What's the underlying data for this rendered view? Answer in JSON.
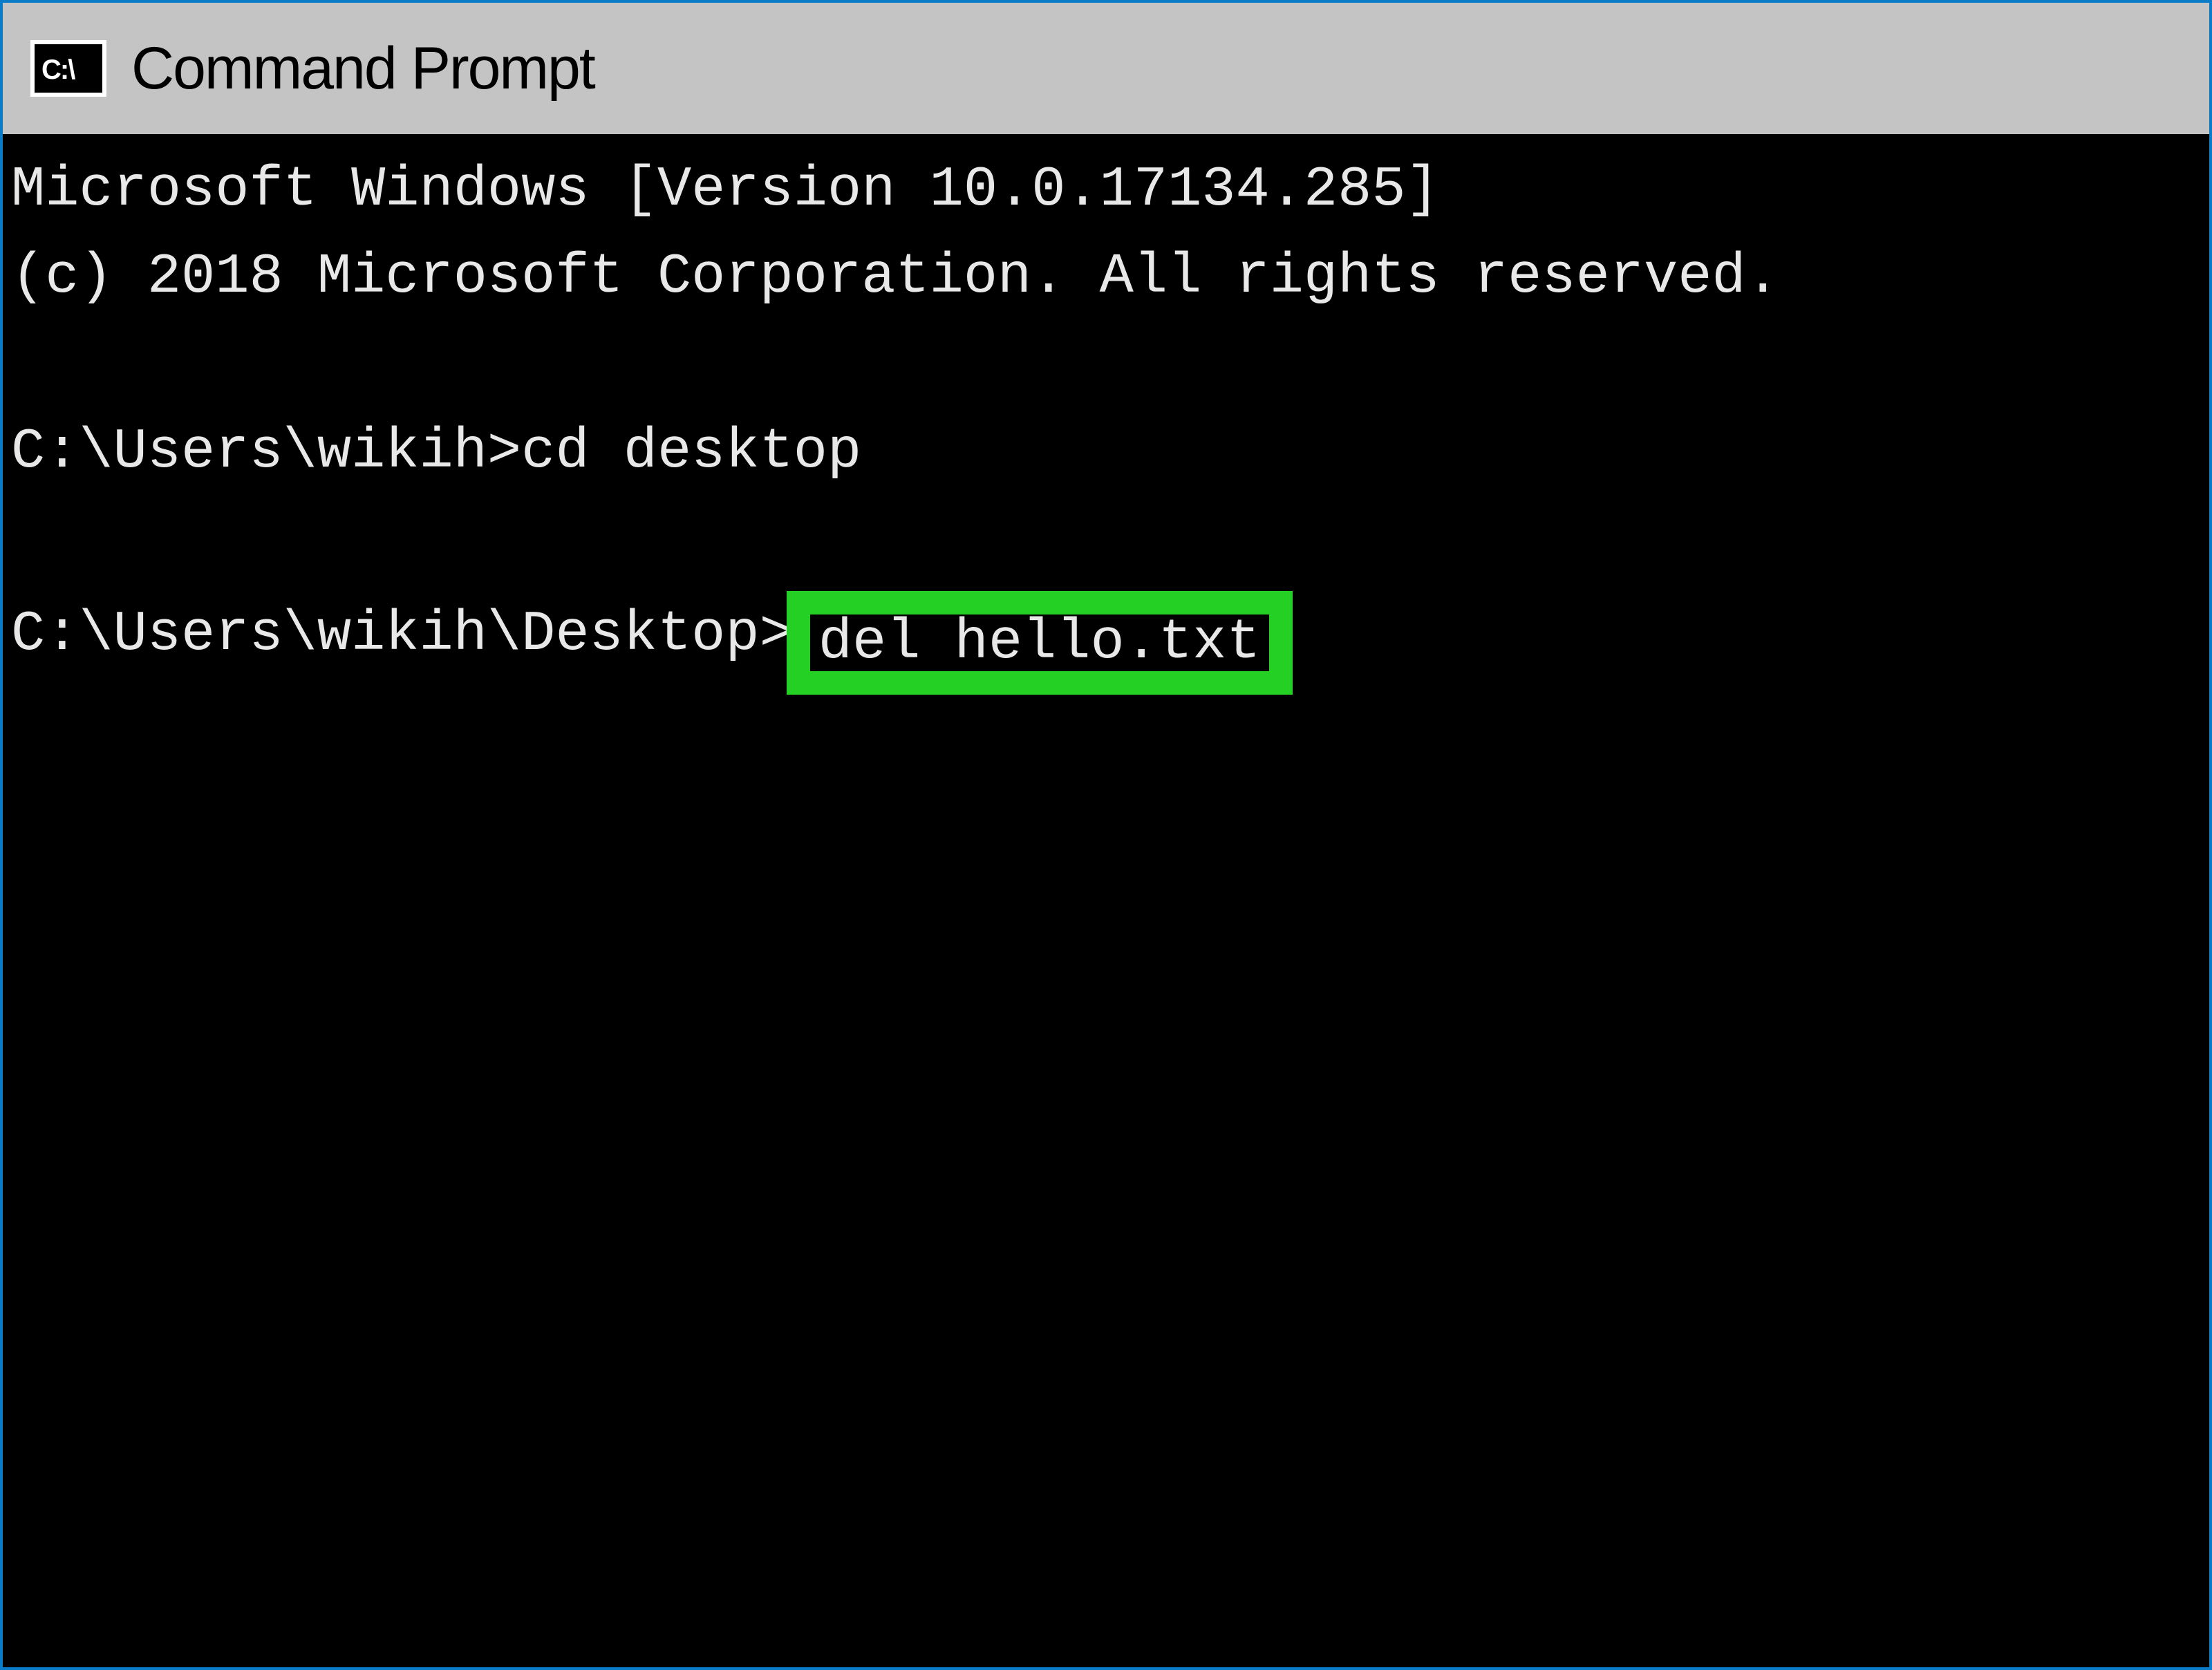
{
  "window": {
    "title": "Command Prompt",
    "icon_label": "C:\\"
  },
  "terminal": {
    "banner_line1": "Microsoft Windows [Version 10.0.17134.285]",
    "banner_line2": "(c) 2018 Microsoft Corporation. All rights reserved.",
    "prompt1": "C:\\Users\\wikih>",
    "command1": "cd desktop",
    "prompt2": "C:\\Users\\wikih\\Desktop>",
    "command2": "del hello.txt"
  },
  "colors": {
    "border": "#0a7cc7",
    "titlebar_bg": "#c4c4c4",
    "terminal_bg": "#000000",
    "terminal_fg": "#e8e8e8",
    "highlight": "#25d025"
  }
}
